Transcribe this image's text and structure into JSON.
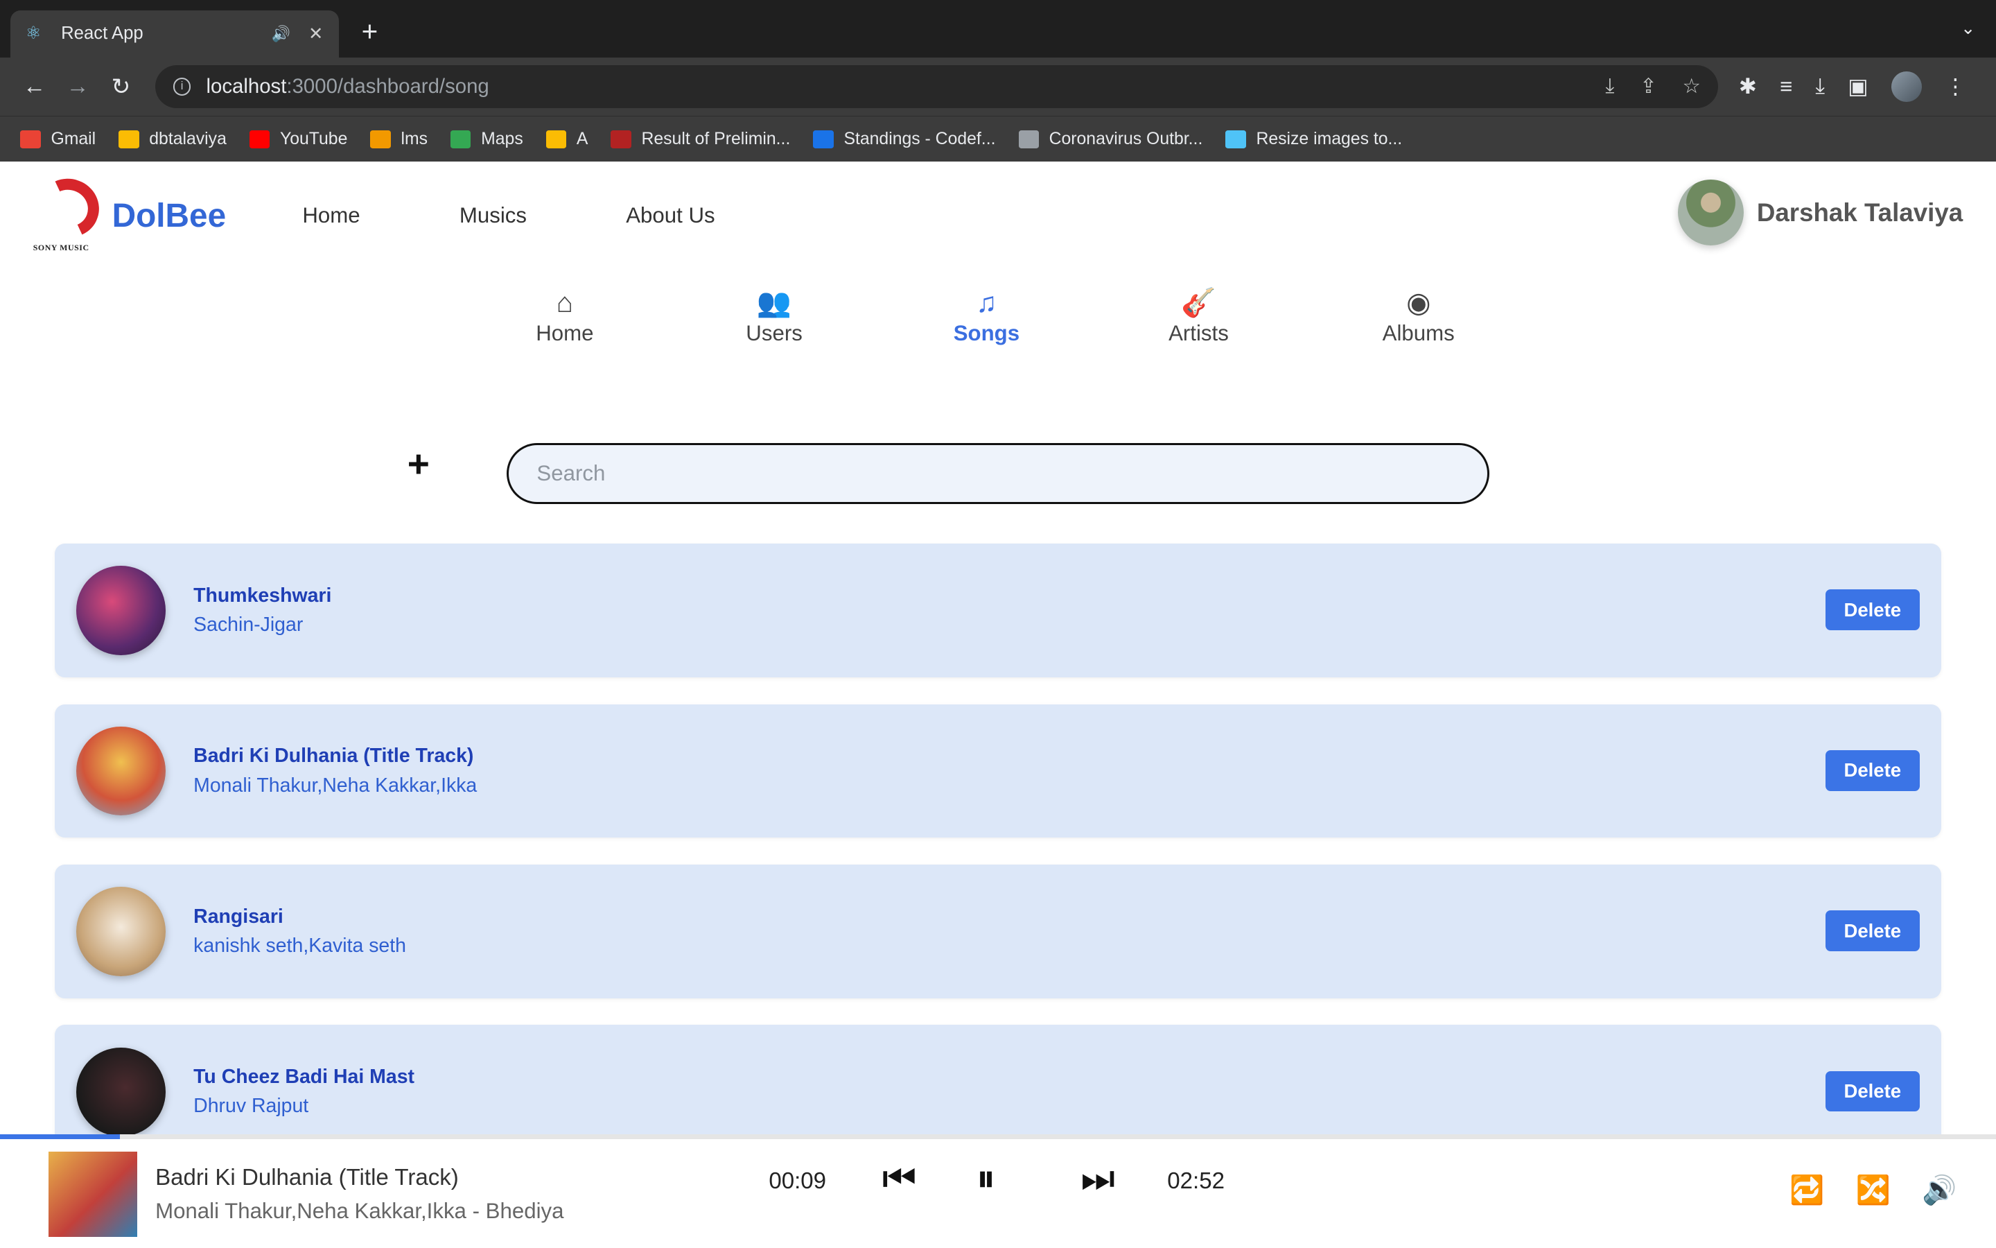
{
  "browser": {
    "tab_title": "React App",
    "url_host": "localhost",
    "url_path": ":3000/dashboard/song",
    "bookmarks": [
      {
        "label": "Gmail",
        "color": "#ea4335"
      },
      {
        "label": "dbtalaviya",
        "color": "#fbbc04"
      },
      {
        "label": "YouTube",
        "color": "#ff0000"
      },
      {
        "label": "lms",
        "color": "#f29900"
      },
      {
        "label": "Maps",
        "color": "#34a853"
      },
      {
        "label": "A",
        "color": "#fbbc04"
      },
      {
        "label": "Result of Prelimin...",
        "color": "#b22222"
      },
      {
        "label": "Standings - Codef...",
        "color": "#1a73e8"
      },
      {
        "label": "Coronavirus Outbr...",
        "color": "#9aa0a6"
      },
      {
        "label": "Resize images to...",
        "color": "#4fc3f7"
      }
    ]
  },
  "app": {
    "brand": "DolBee",
    "logo_text": "SONY MUSIC",
    "top_nav": [
      "Home",
      "Musics",
      "About Us"
    ],
    "user_name": "Darshak Talaviya"
  },
  "dashboard_nav": [
    {
      "label": "Home",
      "icon": "home-icon",
      "active": false
    },
    {
      "label": "Users",
      "icon": "users-icon",
      "active": false
    },
    {
      "label": "Songs",
      "icon": "music-icon",
      "active": true
    },
    {
      "label": "Artists",
      "icon": "guitar-icon",
      "active": false
    },
    {
      "label": "Albums",
      "icon": "disc-icon",
      "active": false
    }
  ],
  "search": {
    "placeholder": "Search",
    "value": ""
  },
  "songs": [
    {
      "title": "Thumkeshwari",
      "artist": "Sachin-Jigar",
      "delete_label": "Delete"
    },
    {
      "title": "Badri Ki Dulhania (Title Track)",
      "artist": "Monali Thakur,Neha Kakkar,Ikka",
      "delete_label": "Delete"
    },
    {
      "title": "Rangisari",
      "artist": "kanishk seth,Kavita seth",
      "delete_label": "Delete"
    },
    {
      "title": "Tu Cheez Badi Hai Mast",
      "artist": "Dhruv Rajput",
      "delete_label": "Delete"
    }
  ],
  "player": {
    "title": "Badri Ki Dulhania (Title Track)",
    "subtitle": "Monali Thakur,Neha Kakkar,Ikka - Bhediya",
    "current_time": "00:09",
    "duration": "02:52",
    "progress_fraction": 0.06
  },
  "colors": {
    "accent": "#3b74e6",
    "row_bg": "#dce7f8",
    "title_blue": "#1f3fb5"
  }
}
